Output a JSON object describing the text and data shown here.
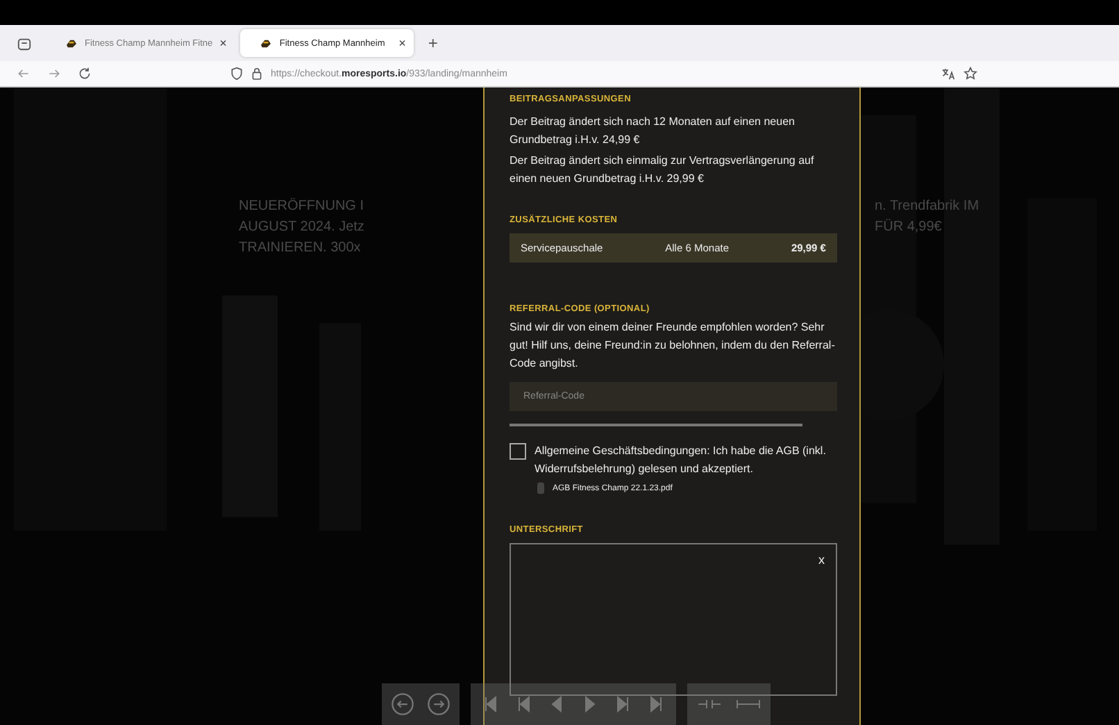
{
  "browser": {
    "tabs": [
      {
        "title": "Fitness Champ Mannheim Fitne",
        "selected": false,
        "close": "×"
      },
      {
        "title": "Fitness Champ Mannheim",
        "selected": true,
        "close": "×"
      }
    ],
    "new_tab": "+",
    "url_prefix": "https://checkout.",
    "url_domain": "moresports.io",
    "url_path": "/933/landing/mannheim"
  },
  "background_text": {
    "left": [
      "NEUERÖFFNUNG I",
      "AUGUST 2024. Jetz",
      "TRAINIEREN. 300x"
    ],
    "right": [
      "n. Trendfabrik IM",
      "FÜR 4,99€"
    ]
  },
  "modal": {
    "adjustments": {
      "heading": "BEITRAGSANPASSUNGEN",
      "paragraphs": [
        "Der Beitrag ändert sich nach 12 Monaten auf einen neuen Grundbetrag i.H.v. 24,99 €",
        "Der Beitrag ändert sich einmalig zur Vertragsverlängerung auf einen neuen Grundbetrag i.H.v. 29,99 €"
      ]
    },
    "costs": {
      "heading": "ZUSÄTZLICHE KOSTEN",
      "rows": [
        {
          "name": "Servicepauschale",
          "interval": "Alle 6 Monate",
          "price": "29,99 €"
        }
      ]
    },
    "referral": {
      "heading": "REFERRAL-CODE (OPTIONAL)",
      "text": "Sind wir dir von einem deiner Freunde empfohlen worden? Sehr gut! Hilf uns, deine Freund:in zu belohnen, indem du den Referral-Code angibst.",
      "placeholder": "Referral-Code"
    },
    "terms": {
      "checked": false,
      "label": "Allgemeine Geschäftsbedingungen: Ich habe die AGB (inkl. Widerrufsbelehrung) gelesen und akzeptiert.",
      "file": "AGB Fitness Champ 22.1.23.pdf"
    },
    "signature": {
      "heading": "UNTERSCHRIFT",
      "clear": "x"
    }
  }
}
